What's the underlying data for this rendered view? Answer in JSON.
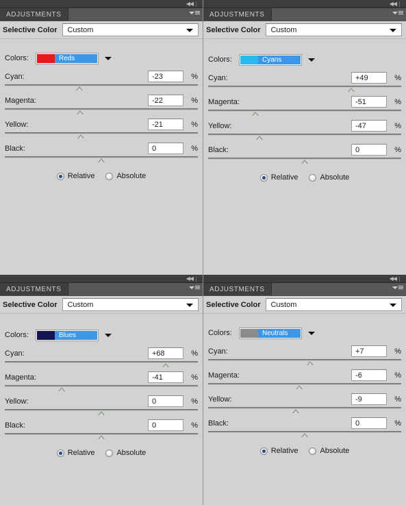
{
  "app": {
    "panel_tab_label": "ADJUSTMENTS",
    "adjustment_title": "Selective Color",
    "preset_value": "Custom",
    "preset_placeholder": "Custom",
    "colors_label": "Colors:",
    "percent_symbol": "%",
    "channel_labels": [
      "Cyan:",
      "Magenta:",
      "Yellow:",
      "Black:"
    ],
    "method_relative": "Relative",
    "method_absolute": "Absolute",
    "accent_highlight": "#3c97e8",
    "panel_bg": "#d2d2d2",
    "tab_bg": "#3f3f3f",
    "slider_thumb": "#879e87"
  },
  "panels": [
    {
      "id": "panel-reds",
      "position": "top-left",
      "color_name": "Reds",
      "swatch_color": "#e21b1b",
      "preset": "Custom",
      "channels": [
        {
          "label": "Cyan:",
          "value": "-23",
          "pos_pct": 38.5
        },
        {
          "label": "Magenta:",
          "value": "-22",
          "pos_pct": 39.0
        },
        {
          "label": "Yellow:",
          "value": "-21",
          "pos_pct": 39.5
        },
        {
          "label": "Black:",
          "value": "0",
          "pos_pct": 50.0
        }
      ],
      "method": "Relative"
    },
    {
      "id": "panel-cyans",
      "position": "top-right",
      "color_name": "Cyans",
      "swatch_color": "#2bb9ef",
      "preset": "Custom",
      "channels": [
        {
          "label": "Cyan:",
          "value": "+49",
          "pos_pct": 74.0
        },
        {
          "label": "Magenta:",
          "value": "-51",
          "pos_pct": 24.5
        },
        {
          "label": "Yellow:",
          "value": "-47",
          "pos_pct": 26.5
        },
        {
          "label": "Black:",
          "value": "0",
          "pos_pct": 50.0
        }
      ],
      "method": "Relative"
    },
    {
      "id": "panel-blues",
      "position": "bottom-left",
      "color_name": "Blues",
      "swatch_color": "#161654",
      "preset": "Custom",
      "channels": [
        {
          "label": "Cyan:",
          "value": "+68",
          "pos_pct": 83.5
        },
        {
          "label": "Magenta:",
          "value": "-41",
          "pos_pct": 29.5
        },
        {
          "label": "Yellow:",
          "value": "0",
          "pos_pct": 50.0
        },
        {
          "label": "Black:",
          "value": "0",
          "pos_pct": 50.0
        }
      ],
      "method": "Relative"
    },
    {
      "id": "panel-neutrals",
      "position": "bottom-right",
      "color_name": "Neutrals",
      "swatch_color": "#8b8b8b",
      "preset": "Custom",
      "channels": [
        {
          "label": "Cyan:",
          "value": "+7",
          "pos_pct": 53.0
        },
        {
          "label": "Magenta:",
          "value": "-6",
          "pos_pct": 47.0
        },
        {
          "label": "Yellow:",
          "value": "-9",
          "pos_pct": 45.5
        },
        {
          "label": "Black:",
          "value": "0",
          "pos_pct": 50.0
        }
      ],
      "method": "Relative"
    }
  ]
}
